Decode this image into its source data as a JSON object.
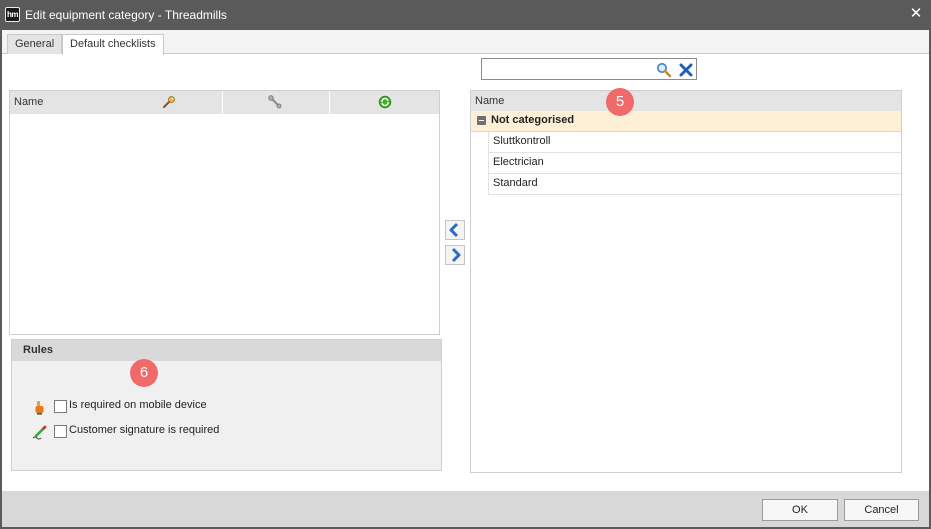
{
  "window": {
    "app_icon_text": "hm",
    "title": "Edit equipment category - Threadmills",
    "close_glyph": "✕"
  },
  "tabs": [
    {
      "label": "General",
      "active": false
    },
    {
      "label": "Default checklists",
      "active": true
    }
  ],
  "search": {
    "value": "",
    "placeholder": "",
    "search_icon": "magnifier-icon",
    "clear_icon": "clear-x-icon"
  },
  "left_table": {
    "columns": [
      {
        "label": "Name"
      },
      {
        "icon": "wrench-orange-icon"
      },
      {
        "icon": "wrench-gray-icon"
      },
      {
        "icon": "green-recycle-icon"
      }
    ],
    "rows": []
  },
  "rules": {
    "title": "Rules",
    "items": [
      {
        "label": "Is required on mobile device",
        "icon": "mobile-hand-icon",
        "checked": false
      },
      {
        "label": "Customer signature is required",
        "icon": "signature-pen-icon",
        "checked": false
      }
    ]
  },
  "transfer": {
    "move_left": "chevron-left-icon",
    "move_right": "chevron-right-icon"
  },
  "right_list": {
    "header": "Name",
    "groups": [
      {
        "label": "Not categorised",
        "expanded": true,
        "items": [
          "Sluttkontroll",
          "Electrician",
          "Standard"
        ]
      }
    ]
  },
  "badges": {
    "right": "5",
    "rules": "6"
  },
  "footer": {
    "ok_label": "OK",
    "cancel_label": "Cancel"
  },
  "colors": {
    "titlebar": "#5a5a5a",
    "badge": "#f06a6a",
    "group_highlight": "#fdf0d6",
    "arrow_blue": "#2d6bc8"
  }
}
